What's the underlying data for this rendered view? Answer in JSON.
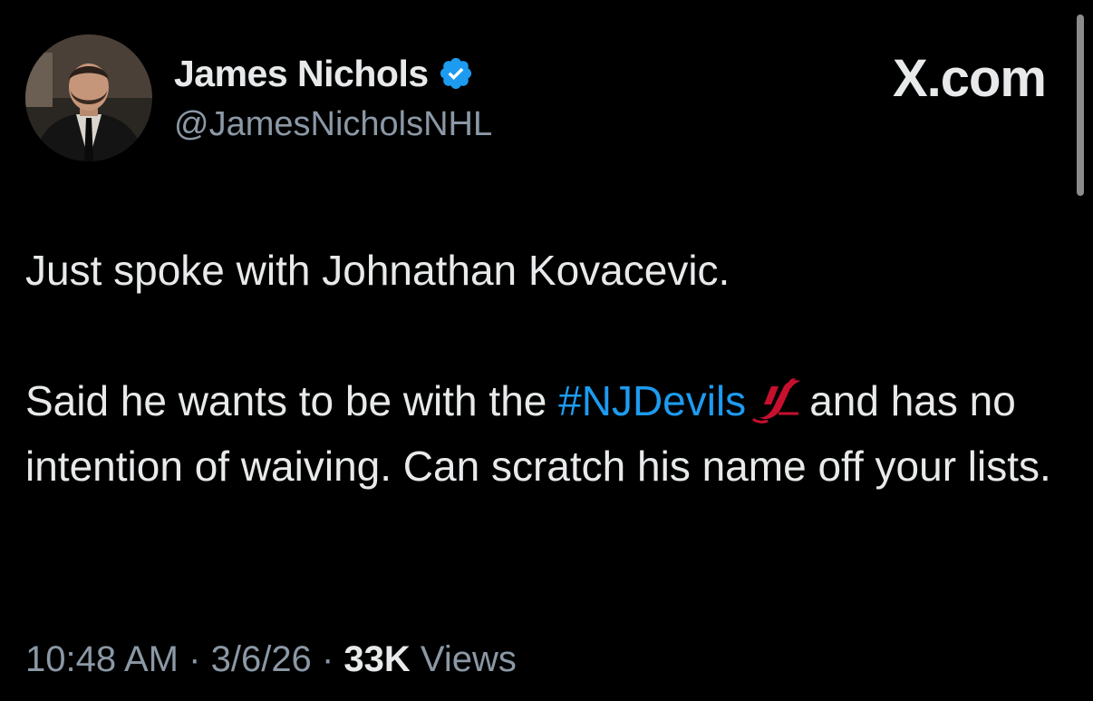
{
  "author": {
    "display_name": "James Nichols",
    "handle": "@JamesNicholsNHL",
    "verified": true,
    "verified_color": "#1d9bf0"
  },
  "brand": {
    "label": "X.com"
  },
  "tweet": {
    "paragraph1": "Just spoke with Johnathan Kovacevic.",
    "paragraph2_before": "Said he wants to be with the",
    "hashtag": "#NJDevils",
    "emoji_icon": "nj-devils-logo-icon",
    "paragraph2_after": "and has no intention of waiving. Can scratch his name off your lists."
  },
  "meta": {
    "time": "10:48 AM",
    "sep1": "·",
    "date": "3/6/26",
    "sep2": "·",
    "views_count": "33K",
    "views_label": "Views"
  },
  "colors": {
    "background": "#000000",
    "text": "#e7e9ea",
    "secondary": "#8b98a5",
    "link": "#1d9bf0",
    "devils_red": "#c8102e"
  }
}
